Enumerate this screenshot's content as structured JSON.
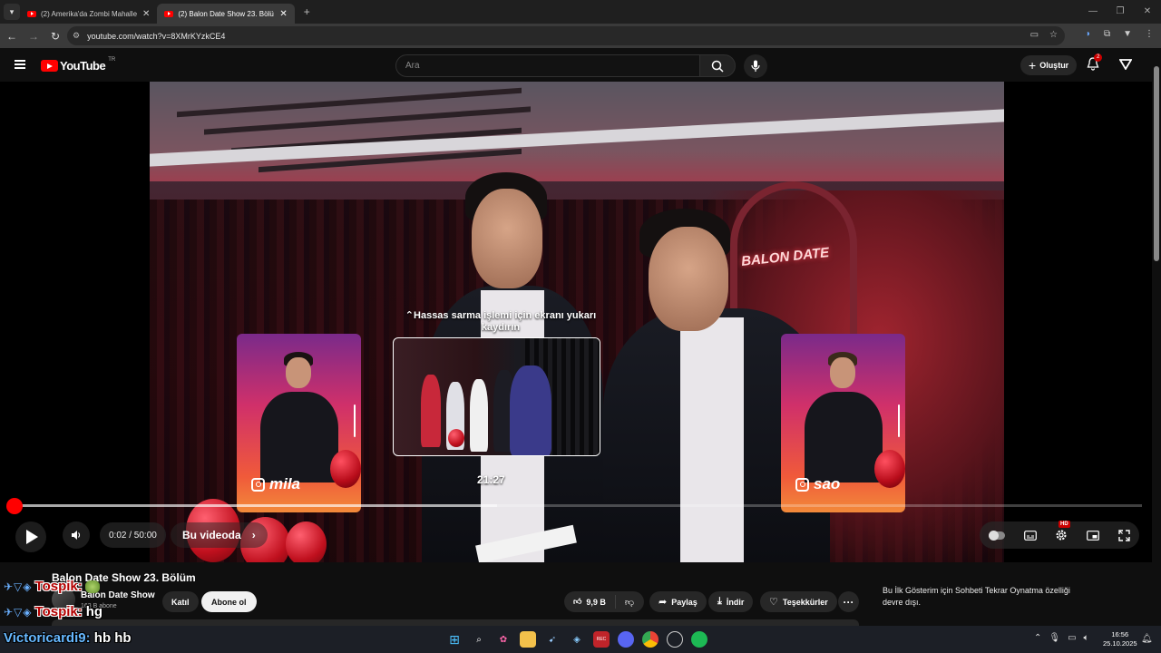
{
  "browser": {
    "tabs": [
      {
        "title": "(2) Amerika'da Zombi Mahalles",
        "active": false
      },
      {
        "title": "(2) Balon Date Show 23. Bölüm",
        "active": true
      }
    ],
    "url": "youtube.com/watch?v=8XMrKYzkCE4"
  },
  "youtube": {
    "logo_text": "YouTube",
    "country_code": "TR",
    "search_placeholder": "Ara",
    "create_label": "Oluştur",
    "notification_count": "2"
  },
  "player": {
    "cards": [
      {
        "handle": "mila"
      },
      {
        "handle": "sao"
      }
    ],
    "scrub_hint": "⌃Hassas sarma işlemi için ekranı yukarı kaydırın",
    "preview_time": "21:27",
    "time_display": "0:02 / 50:00",
    "chapter_label": "Bu videoda",
    "played_fraction": 0.0007,
    "loaded_fraction": 0.43,
    "quality_badge": "HD"
  },
  "video": {
    "title": "Balon Date Show 23. Bölüm",
    "channel": "Balon Date Show",
    "subscribers": "163 B abone",
    "join_label": "Katıl",
    "subscribe_label": "Abone ol",
    "likes": "9,9 B",
    "share_label": "Paylaş",
    "download_label": "İndir",
    "thanks_label": "Teşekkürler",
    "chat_notice": "Bu İlk Gösterim için Sohbeti Tekrar Oynatma özelliği devre dışı."
  },
  "stream_chat": [
    {
      "user": "Tospik:",
      "message": ""
    },
    {
      "user": "Tospik:",
      "message": "hg"
    }
  ],
  "taskbar": {
    "user": "Victoricardi9:",
    "message": "hb hb",
    "time": "16:56",
    "date": "25.10.2025"
  },
  "colors": {
    "youtube_red": "#ff0000",
    "background": "#0f0f0f",
    "accent_blue": "#3ea6ff"
  }
}
